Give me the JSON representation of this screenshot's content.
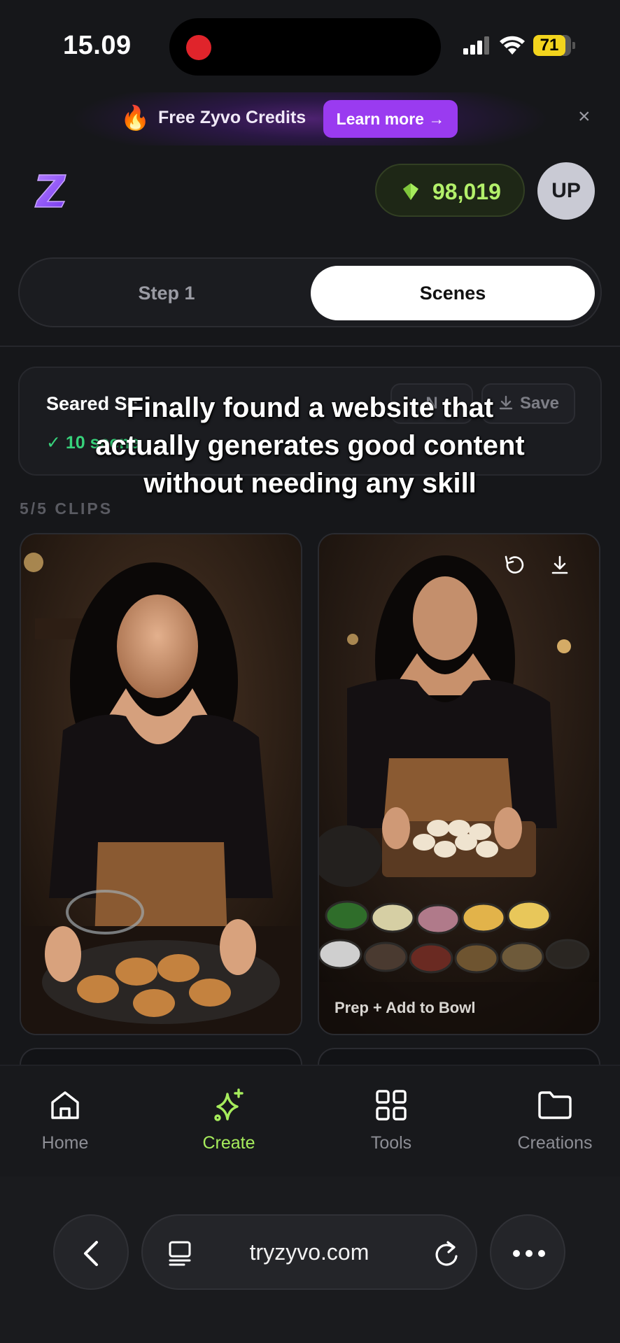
{
  "status_bar": {
    "time": "15.09",
    "battery": "71"
  },
  "promo": {
    "icon": "fire-icon",
    "text": "Free Zyvo Credits",
    "cta": "Learn more →",
    "close": "×"
  },
  "header": {
    "credits": "98,019",
    "avatar": "UP"
  },
  "tabs": [
    {
      "label": "Step 1"
    },
    {
      "label": "Scenes"
    }
  ],
  "project": {
    "title": "Seared Sc",
    "meta": "✓ 10 scene",
    "new_label": "N",
    "save_label": "Save"
  },
  "clips_label": "5/5 CLIPS",
  "clips": [
    {
      "caption": ""
    },
    {
      "caption": "Prep + Add to Bowl"
    }
  ],
  "overlay_text": "Finally found a website that actually generates good content without needing any skill",
  "nav": [
    {
      "label": "Home",
      "icon": "home-icon"
    },
    {
      "label": "Create",
      "icon": "sparkle-icon"
    },
    {
      "label": "Tools",
      "icon": "grid-icon"
    },
    {
      "label": "Creations",
      "icon": "folder-icon"
    }
  ],
  "browser": {
    "url": "tryzyvo.com"
  },
  "colors": {
    "accent": "#a6ec5c",
    "promo": "#9a3bf0",
    "success": "#37d27b"
  }
}
